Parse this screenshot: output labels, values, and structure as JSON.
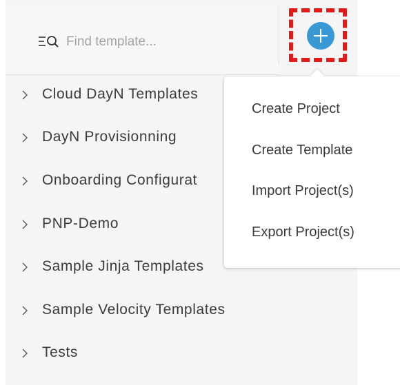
{
  "search": {
    "placeholder": "Find template...",
    "value": ""
  },
  "toolbar": {
    "add_button_icon": "plus-circle-icon",
    "accent_color": "#3a99d4",
    "highlight_color": "#e01b1b"
  },
  "tree": {
    "items": [
      {
        "label": "Cloud DayN Templates"
      },
      {
        "label": "DayN Provisionning"
      },
      {
        "label": "Onboarding Configurat"
      },
      {
        "label": "PNP-Demo"
      },
      {
        "label": "Sample Jinja Templates"
      },
      {
        "label": "Sample Velocity Templates"
      },
      {
        "label": "Tests"
      }
    ]
  },
  "menu": {
    "items": [
      {
        "label": "Create Project"
      },
      {
        "label": "Create Template"
      },
      {
        "label": "Import Project(s)"
      },
      {
        "label": "Export Project(s)"
      }
    ]
  }
}
